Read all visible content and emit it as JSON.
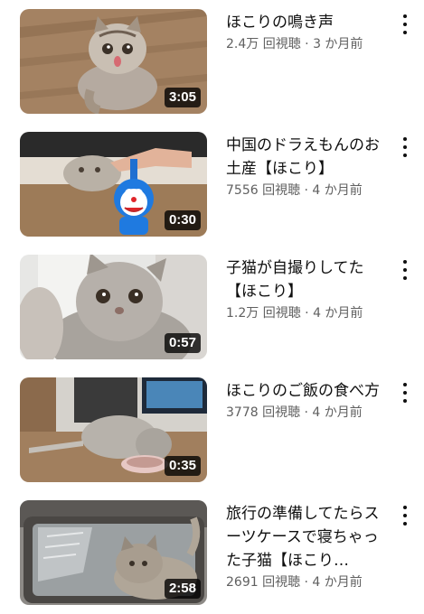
{
  "videos": [
    {
      "title": "ほこりの鳴き声",
      "meta": "2.4万 回視聴 · 3 か月前",
      "duration": "3:05",
      "thumbnail_icon": "cat-on-floor-thumbnail"
    },
    {
      "title": "中国のドラえもんのお土産【ほこり】",
      "meta": "7556 回視聴 · 4 か月前",
      "duration": "0:30",
      "thumbnail_icon": "doraemon-toy-thumbnail"
    },
    {
      "title": "子猫が自撮りしてた【ほこり】",
      "meta": "1.2万 回視聴 · 4 か月前",
      "duration": "0:57",
      "thumbnail_icon": "kitten-selfie-thumbnail"
    },
    {
      "title": "ほこりのご飯の食べ方",
      "meta": "3778 回視聴 · 4 か月前",
      "duration": "0:35",
      "thumbnail_icon": "cat-eating-thumbnail"
    },
    {
      "title": "旅行の準備してたらスーツケースで寝ちゃった子猫【ほこり…",
      "meta": "2691 回視聴 · 4 か月前",
      "duration": "2:58",
      "thumbnail_icon": "kitten-suitcase-thumbnail"
    }
  ],
  "menu_icon": "more-vert-icon"
}
